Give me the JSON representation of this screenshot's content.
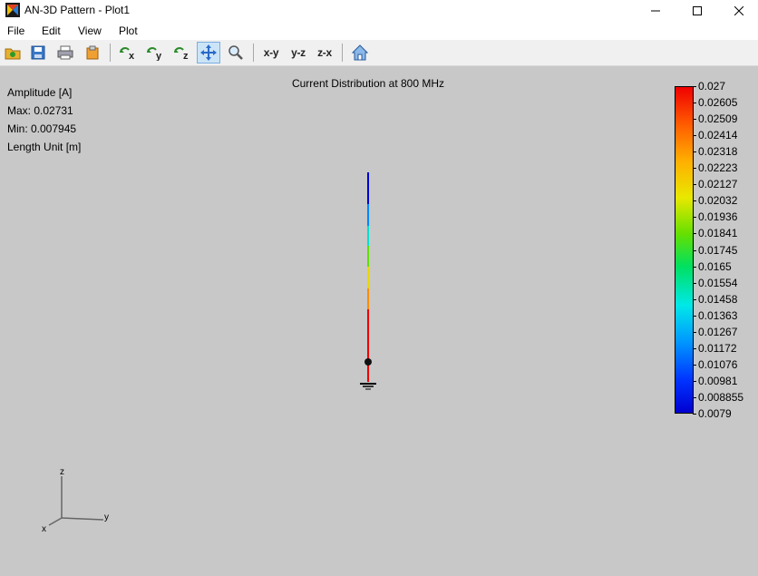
{
  "window": {
    "title": "AN-3D Pattern - Plot1"
  },
  "menu": [
    "File",
    "Edit",
    "View",
    "Plot"
  ],
  "toolbar": {
    "view_buttons": [
      "x-y",
      "y-z",
      "z-x"
    ]
  },
  "info": {
    "amplitude": "Amplitude [A]",
    "max": "Max: 0.02731",
    "min": "Min: 0.007945",
    "length_unit": "Length Unit [m]"
  },
  "plot": {
    "title": "Current Distribution at 800 MHz"
  },
  "colorbar": {
    "labels": [
      "0.027",
      "0.02605",
      "0.02509",
      "0.02414",
      "0.02318",
      "0.02223",
      "0.02127",
      "0.02032",
      "0.01936",
      "0.01841",
      "0.01745",
      "0.0165",
      "0.01554",
      "0.01458",
      "0.01363",
      "0.01267",
      "0.01172",
      "0.01076",
      "0.00981",
      "0.008855",
      "0.0079"
    ],
    "colors": [
      "#f00000",
      "#ff6000",
      "#ffb000",
      "#e8e800",
      "#66e000",
      "#00e060",
      "#00e8e8",
      "#0099ff",
      "#0033ff",
      "#0000d0"
    ]
  },
  "axes": {
    "x": "x",
    "y": "y",
    "z": "z"
  }
}
